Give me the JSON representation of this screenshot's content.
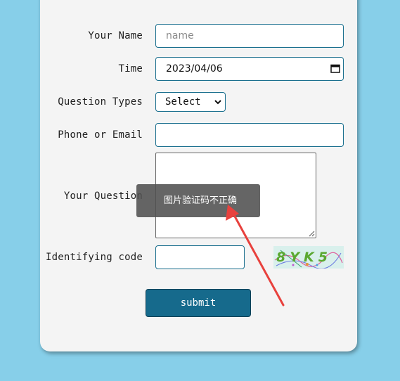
{
  "form": {
    "name_label": "Your Name",
    "name_placeholder": "name",
    "time_label": "Time",
    "time_value": "2023/04/06",
    "question_type_label": "Question Types",
    "question_type_value": "Select",
    "contact_label": "Phone or Email",
    "contact_value": "",
    "question_label": "Your Question",
    "question_value": "",
    "code_label": "Identifying code",
    "code_value": "",
    "captcha_text": "8YK5",
    "submit_label": "submit"
  },
  "toast": {
    "message": "图片验证码不正确"
  },
  "colors": {
    "page_background": "#87cfe9",
    "card_background": "#f4f4f4",
    "field_border": "#1a6f8e",
    "submit_background": "#166a8c",
    "annotation_arrow": "#e8413d"
  },
  "icons": {
    "time_field": "calendar-icon",
    "question_type_select": "chevron-down-icon",
    "textarea": "resize-grip-icon"
  }
}
